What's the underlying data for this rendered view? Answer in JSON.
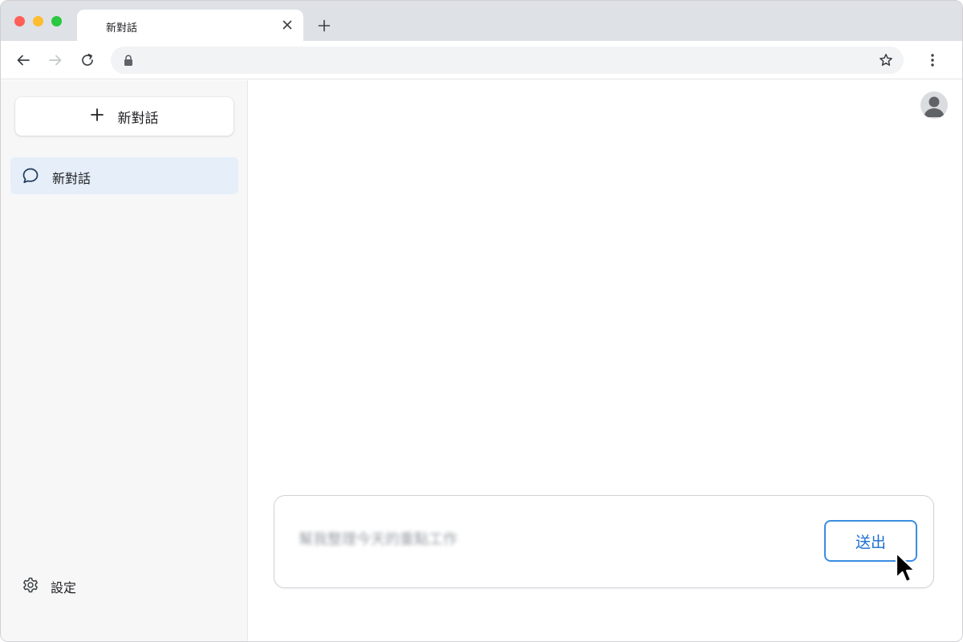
{
  "tab": {
    "title": "新對話"
  },
  "sidebar": {
    "new_chat_label": "新對話",
    "items": [
      {
        "label": "新對話",
        "active": true
      }
    ],
    "settings_label": "設定"
  },
  "composer": {
    "input_value": "幫我整理今天的重點工作",
    "send_label": "送出"
  },
  "colors": {
    "accent": "#1a6fd1",
    "active_item_bg": "#e5eef9",
    "tabstrip_bg": "#dee1e6"
  }
}
